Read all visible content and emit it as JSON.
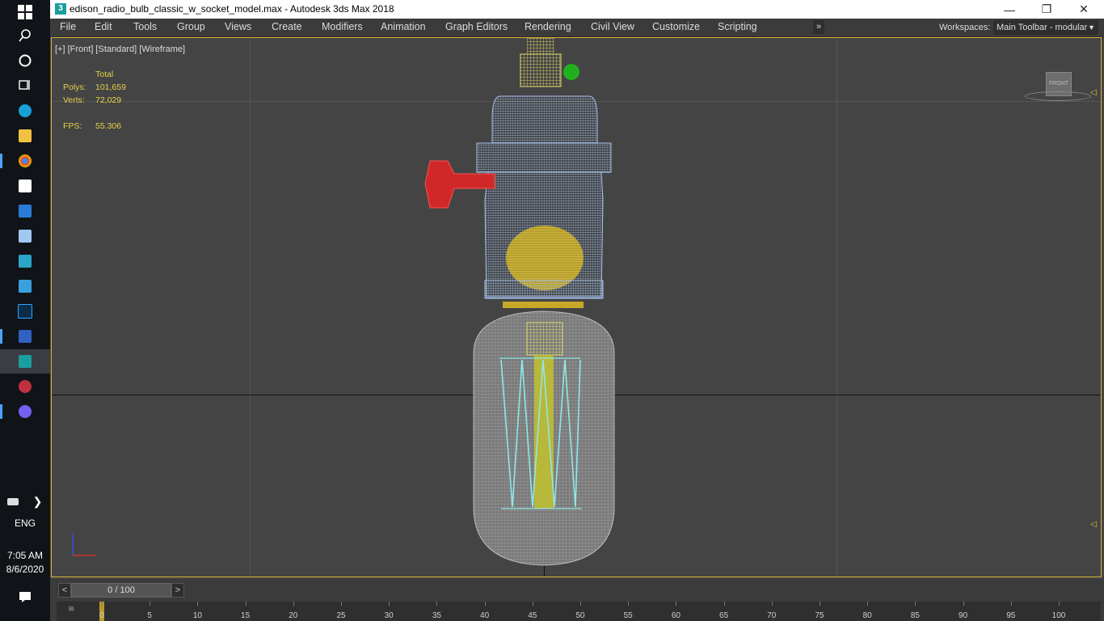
{
  "window": {
    "title": "edison_radio_bulb_classic_w_socket_model.max - Autodesk 3ds Max 2018",
    "app_icon": "3"
  },
  "menu": {
    "items": [
      "File",
      "Edit",
      "Tools",
      "Group",
      "Views",
      "Create",
      "Modifiers",
      "Animation",
      "Graph Editors",
      "Rendering",
      "Civil View",
      "Customize",
      "Scripting"
    ],
    "more": "»",
    "workspaces_label": "Workspaces:",
    "workspace_value": "Main Toolbar - modular"
  },
  "viewport": {
    "label": "[+] [Front] [Standard] [Wireframe]",
    "stats": {
      "total_label": "Total",
      "polys_label": "Polys:",
      "polys_value": "101,659",
      "verts_label": "Verts:",
      "verts_value": "72,029",
      "fps_label": "FPS:",
      "fps_value": "55.306"
    },
    "viewcube_label": "FRONT"
  },
  "timeline": {
    "prev": "<",
    "slider_text": "0 / 100",
    "next": ">",
    "ticks": [
      "0",
      "5",
      "10",
      "15",
      "20",
      "25",
      "30",
      "35",
      "40",
      "45",
      "50",
      "55",
      "60",
      "65",
      "70",
      "75",
      "80",
      "85",
      "90",
      "95",
      "100"
    ]
  },
  "taskbar": {
    "lang": "ENG",
    "time": "7:05 AM",
    "date": "8/6/2020"
  },
  "colors": {
    "accent": "#d8b23a",
    "wire_blue": "#9fc0f0",
    "wire_yellow": "#e8e070",
    "wire_red": "#d83030",
    "wire_gray": "#9a9a9a",
    "wire_cyan": "#8ee8e8"
  }
}
